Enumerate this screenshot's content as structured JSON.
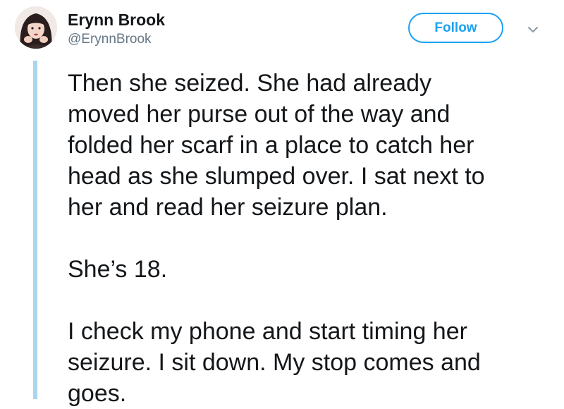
{
  "author": {
    "name": "Erynn Brook",
    "handle": "@ErynnBrook"
  },
  "follow_button": {
    "label": "Follow"
  },
  "icons": {
    "avatar": "profile-photo",
    "caret": "chevron-down-icon"
  },
  "colors": {
    "accent": "#1da1f2",
    "thread_line": "#a9d5ee",
    "handle_text": "#657786",
    "body_text": "#14171a"
  },
  "tweet": {
    "paragraphs": [
      {
        "lines": [
          "Then she seized. She had already",
          "moved her purse out of the way and",
          "folded her scarf in a place to catch her",
          "head as she slumped over. I sat next to",
          "her and read her seizure plan."
        ]
      },
      {
        "lines": [
          "She’s 18."
        ]
      },
      {
        "lines": [
          "I check my phone and start timing her",
          "seizure. I sit down. My stop comes and",
          "goes."
        ]
      }
    ]
  }
}
